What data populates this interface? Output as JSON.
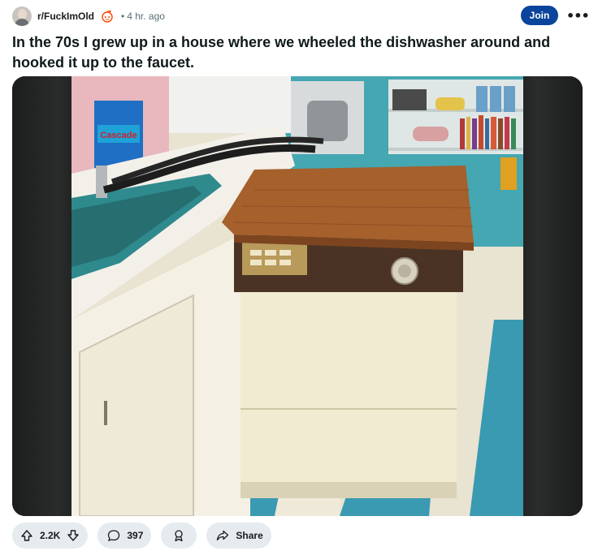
{
  "post": {
    "subreddit": "r/FuckImOld",
    "separator": "•",
    "time": "4 hr. ago",
    "join_label": "Join",
    "more_label": "•••",
    "title": "In the 70s I grew up in a house where we wheeled the dishwasher around and hooked it up to the faucet."
  },
  "photo": {
    "box_brand": "Cascade"
  },
  "actions": {
    "upvotes": "2.2K",
    "comments": "397",
    "share_label": "Share"
  },
  "icons": {
    "avatar": "subreddit-avatar",
    "badge": "reddit-alien-icon",
    "upvote": "arrow-up-icon",
    "downvote": "arrow-down-icon",
    "comment": "comment-bubble-icon",
    "award": "award-icon",
    "share": "share-arrow-icon"
  },
  "colors": {
    "join_bg": "#0a449b",
    "pill_bg": "#e5ebee",
    "counter_top": "#a5602c",
    "tile_blue": "#3a9ab2"
  }
}
